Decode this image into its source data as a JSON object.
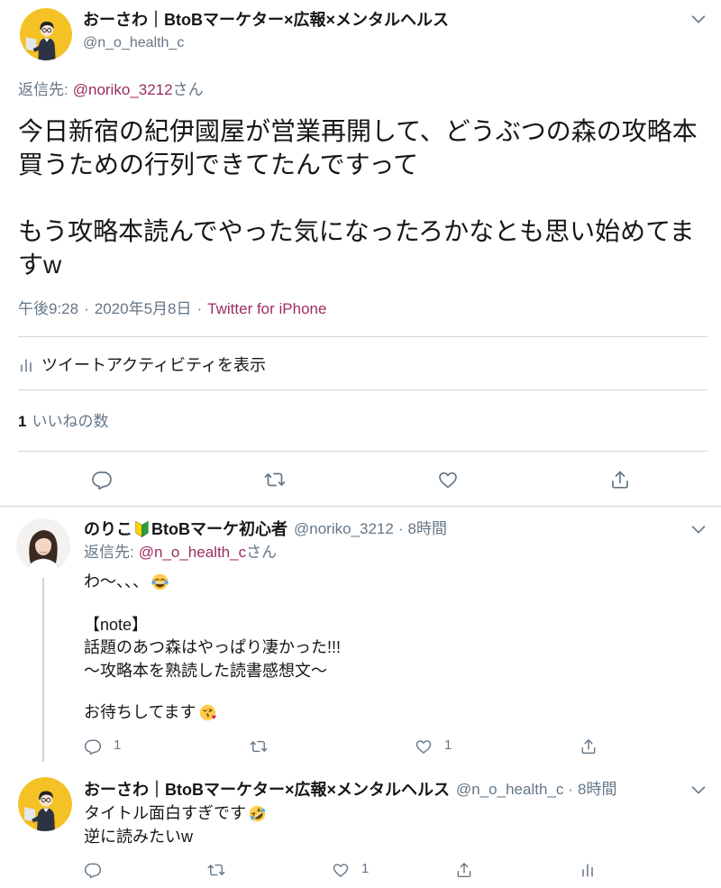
{
  "colors": {
    "text": "#14171a",
    "secondary": "#657786",
    "link": "#9b2d5e",
    "divider": "#ccd6dd",
    "avatar_background": "#f5c225"
  },
  "icons": {
    "more": "chevron-down-icon",
    "reply": "reply-icon",
    "retweet": "retweet-icon",
    "like": "heart-icon",
    "share": "share-icon",
    "analytics": "analytics-icon"
  },
  "main_tweet": {
    "author": {
      "name": "おーさわ｜BtoBマーケター×広報×メンタルヘルス",
      "handle": "@n_o_health_c"
    },
    "reply_to": {
      "label": "返信先:",
      "handle": "@noriko_3212",
      "suffix": "さん"
    },
    "paragraphs": [
      [
        "今日新宿の紀伊國屋が営業再開して、どうぶつの森の攻略本",
        "買うための行列できてたんですって"
      ],
      [
        "もう攻略本読んでやった気になったろかなとも思い始めてま",
        "すw"
      ]
    ],
    "meta": {
      "time": "午後9:28",
      "separator": "·",
      "date": "2020年5月8日",
      "source": "Twitter for iPhone"
    },
    "activity_label": "ツイートアクティビティを表示",
    "likes": {
      "count": "1",
      "label": "いいねの数"
    }
  },
  "replies": [
    {
      "author": {
        "name": "のりこ",
        "badge_icon": "beginner-mark-emoji",
        "name_suffix": "BtoBマーケ初心者",
        "handle": "@noriko_3212",
        "separator": "·",
        "time": "8時間"
      },
      "reply_to": {
        "label": "返信先:",
        "handle": "@n_o_health_c",
        "suffix": "さん"
      },
      "paragraphs": [
        [
          "わ〜、、、"
        ],
        [
          "【note】",
          "話題のあつ森はやっぱり凄かった!!!",
          "〜攻略本を熟読した読書感想文〜"
        ],
        [
          "お待ちしてます"
        ]
      ],
      "emojis": {
        "first_line": "face-with-tears-of-joy",
        "last_line": "face-blowing-a-kiss"
      },
      "actions": {
        "reply_count": "1",
        "like_count": "1"
      }
    },
    {
      "author": {
        "name": "おーさわ｜BtoBマーケター×広報×メンタルヘルス",
        "handle": "@n_o_health_c",
        "separator": "·",
        "time": "8時間"
      },
      "lines": [
        "タイトル面白すぎです",
        "逆に読みたいw"
      ],
      "emojis": {
        "first_line": "rolling-on-the-floor-laughing"
      },
      "actions": {
        "like_count": "1"
      }
    }
  ]
}
